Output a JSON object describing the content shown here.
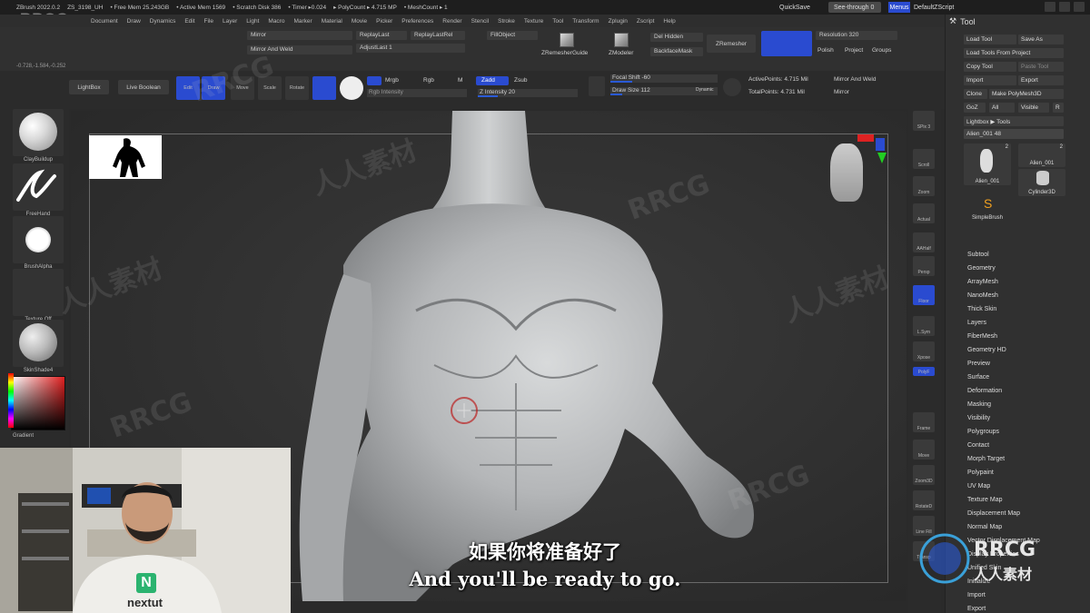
{
  "app": {
    "title_items": [
      "ZBrush 2022.0.2",
      "ZS_3198_UH",
      "• Free Mem 25.243GB",
      "• Active Mem 1569",
      "• Scratch Disk 386",
      "• Timer ▸0.024",
      "▸ PolyCount ▸ 4.715 MP",
      "• MeshCount ▸ 1"
    ],
    "quicksave": "QuickSave",
    "see_through": "See-through  0",
    "menus": "Menus",
    "default_script": "DefaultZScript",
    "watermark_top": "RRCG",
    "coordinates": "-0.728,-1.584,-0.252"
  },
  "menubar": [
    "Document",
    "Draw",
    "Dynamics",
    "Edit",
    "File",
    "Layer",
    "Light",
    "Macro",
    "Marker",
    "Material",
    "Movie",
    "Picker",
    "Preferences",
    "Render",
    "Stencil",
    "Stroke",
    "Texture",
    "Tool",
    "Transform",
    "Zplugin",
    "Zscript",
    "Help"
  ],
  "toolbar1": {
    "mirror": "Mirror",
    "mirror_and_weld": "Mirror And Weld",
    "replay_last": "ReplayLast",
    "replay_last_rel": "ReplayLastRel",
    "adjust_last": "AdjustLast  1",
    "fill_object": "FillObject",
    "zremesher_guide": "ZRemesherGuide",
    "zmodeler": "ZModeler",
    "del_hidden": "Del Hidden",
    "backface_mask": "BackfaceMask",
    "zremesher": "ZRemesher",
    "resolution": "Resolution  320",
    "polish": "Polish",
    "project": "Project",
    "groups": "Groups"
  },
  "toolbar2": {
    "lightbox": "LightBox",
    "live_boolean": "Live Boolean",
    "edit": "Edit",
    "draw": "Draw",
    "move": "Move",
    "scale": "Scale",
    "rotate": "Rotate",
    "mrgb": "Mrgb",
    "rgb": "Rgb",
    "m": "M",
    "rgb_intensity": "Rgb Intensity",
    "zadd": "Zadd",
    "zsub": "Zsub",
    "z_intensity": "Z Intensity  20",
    "focal_shift": "Focal Shift  -60",
    "draw_size": "Draw Size  112",
    "dynamic": "Dynamic",
    "active_points": "ActivePoints: 4.715 Mil",
    "total_points": "TotalPoints: 4.731 Mil",
    "mirror_and_weld": "Mirror And Weld",
    "mirror": "Mirror",
    "z_intensity_value": 0.2,
    "focal_shift_value": -0.6,
    "draw_size_value": 0.11
  },
  "left_shelf": {
    "brush1": "ClayBuildup",
    "brush2": "FreeHand",
    "brush3": "BrushAlpha",
    "texture": "Texture Off",
    "material": "SkinShade4",
    "gradient": "Gradient"
  },
  "right_strip": [
    "SPix 3",
    "Scroll",
    "Zoom",
    "Actual",
    "AAHalf",
    "Persp",
    "Floor",
    "L.Sym",
    "Xpose",
    "PolyF",
    "Frame",
    "Move",
    "Zoom3D",
    "RotateD",
    "Line Fill",
    "Transp"
  ],
  "tool_panel": {
    "header": "Tool",
    "load_tool": "Load Tool",
    "save_as": "Save As",
    "load_from_project": "Load Tools From Project",
    "copy_tool": "Copy Tool",
    "paste_tool": "Paste Tool",
    "import": "Import",
    "export": "Export",
    "clone": "Clone",
    "make_polymesh": "Make PolyMesh3D",
    "goz": "GoZ",
    "all": "All",
    "visible": "Visible",
    "r": "R",
    "lightbox_tools": "Lightbox ▶ Tools",
    "current_tool": "Alien_001  48",
    "thumbs": [
      {
        "name": "Alien_001",
        "count": "2"
      },
      {
        "name": "Alien_001",
        "count": "2"
      },
      {
        "name": "Alien_001",
        "count": ""
      },
      {
        "name": "Cylinder3D",
        "count": ""
      },
      {
        "name": "SimpleBrush",
        "count": ""
      }
    ],
    "subpalettes": [
      "Subtool",
      "Geometry",
      "ArrayMesh",
      "NanoMesh",
      "Thick Skin",
      "Layers",
      "FiberMesh",
      "Geometry HD",
      "Preview",
      "Surface",
      "Deformation",
      "Masking",
      "Visibility",
      "Polygroups",
      "Contact",
      "Morph Target",
      "Polypaint",
      "UV Map",
      "Texture Map",
      "Displacement Map",
      "Normal Map",
      "Vector Displacement Map",
      "Display Properties",
      "Unified Skin",
      "Initialize",
      "Import",
      "Export"
    ]
  },
  "subtitles": {
    "chinese": "如果你将准备好了",
    "english": "And you'll be ready to go."
  },
  "watermarks": {
    "latin": "RRCG",
    "chinese": "人人素材",
    "logo_latin": "RRCG",
    "logo_chinese": "人人素材"
  },
  "webcam": {
    "shirt_text": "nextut",
    "shirt_logo": "N"
  }
}
